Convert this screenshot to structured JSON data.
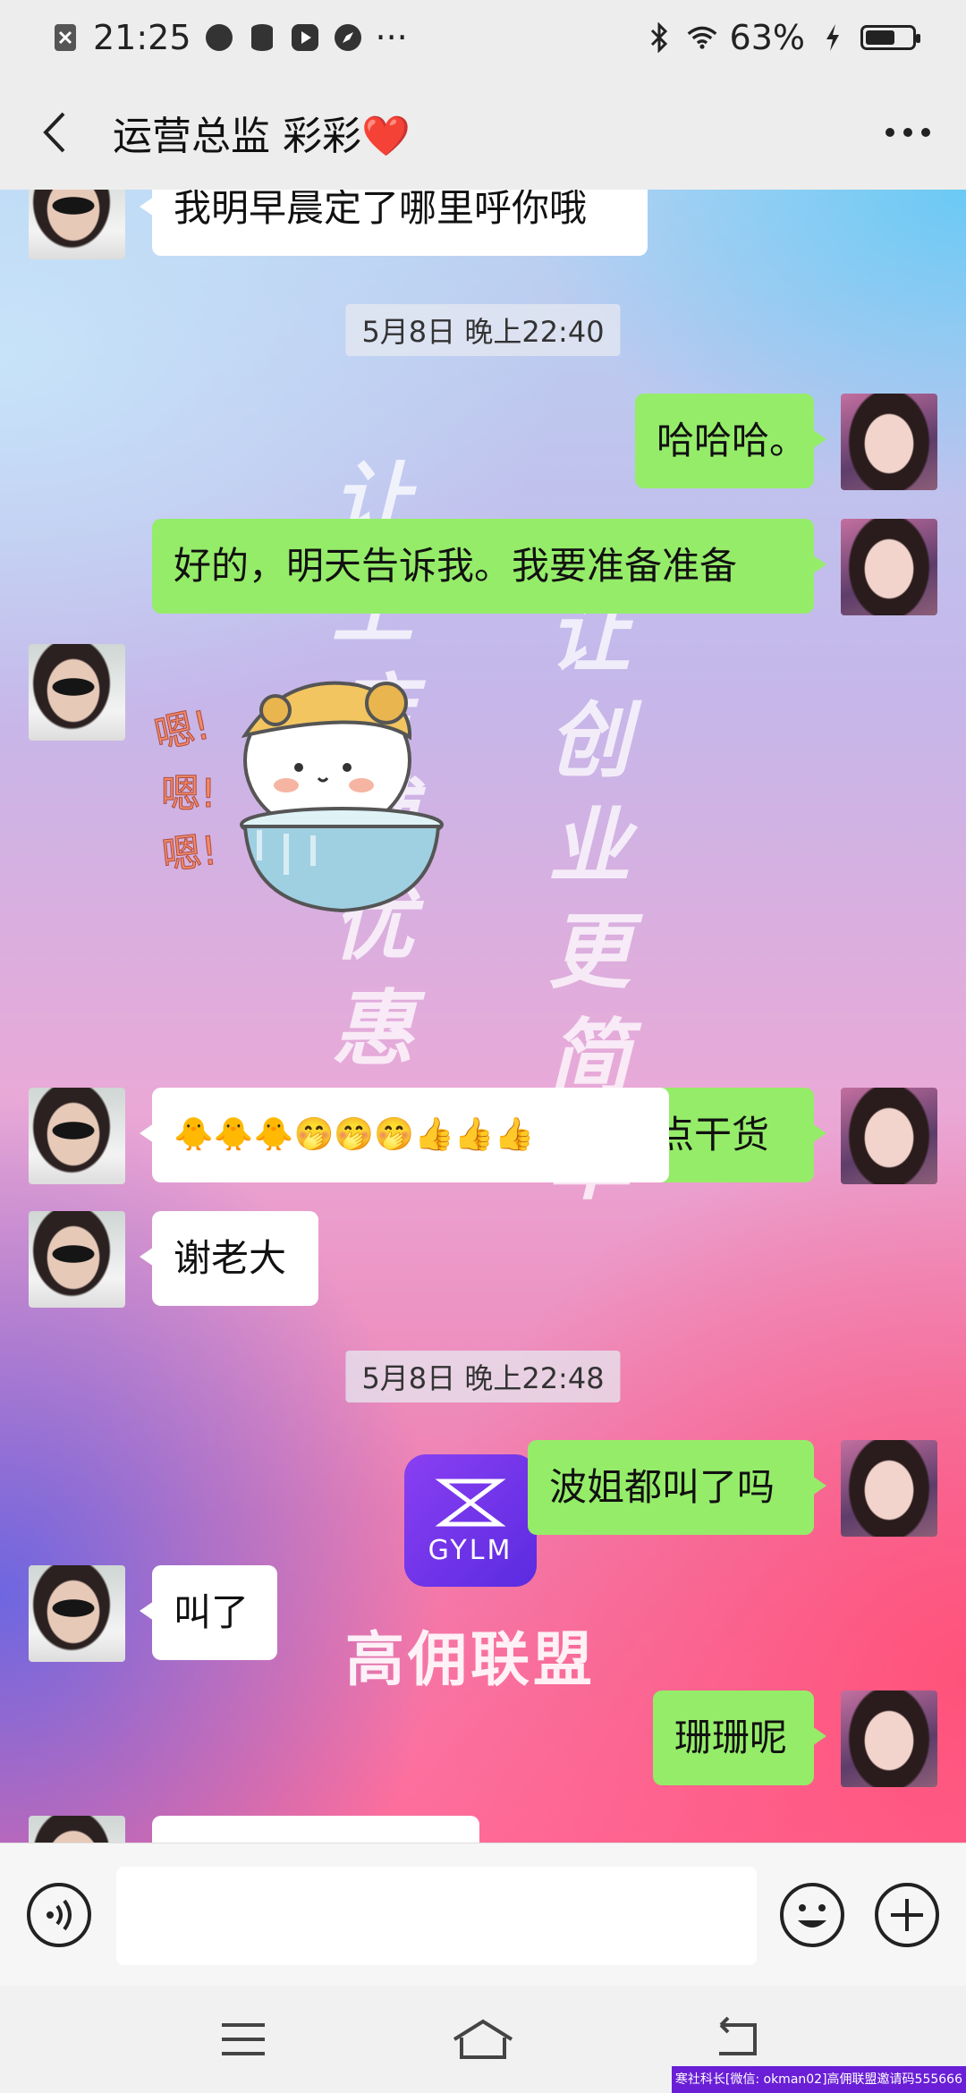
{
  "status_bar": {
    "time": "21:25",
    "more": "···",
    "battery": "63%",
    "battery_level": 0.63
  },
  "header": {
    "back_icon": "chevron-left-icon",
    "title": "运营总监 彩彩❤️",
    "more_icon": "ellipsis-icon"
  },
  "background": {
    "watermark_left": "让上店铺优惠",
    "watermark_right": "让创业更简单",
    "logo_text": "GYLM",
    "brand_name": "高佣联盟"
  },
  "messages": [
    {
      "side": "in",
      "text": "我明早晨定了哪里呼你哦"
    },
    {
      "side": "time",
      "text": "5月8日 晚上22:40"
    },
    {
      "side": "out",
      "text": "哈哈哈。"
    },
    {
      "side": "out",
      "text": "好的，明天告诉我。我要准备准备"
    },
    {
      "side": "in",
      "type": "sticker",
      "sticker_text": [
        "嗯!",
        "嗯!",
        "嗯!"
      ]
    },
    {
      "side": "out",
      "text": "准备分享点干货"
    },
    {
      "side": "in",
      "text": "🐥🐥🐥🤭🤭🤭👍👍👍"
    },
    {
      "side": "in",
      "text": "谢老大"
    },
    {
      "side": "time",
      "text": "5月8日 晚上22:48"
    },
    {
      "side": "out",
      "text": "波姐都叫了吗"
    },
    {
      "side": "in",
      "text": "叫了"
    },
    {
      "side": "out",
      "text": "珊珊呢"
    }
  ],
  "input_bar": {
    "voice_icon": "voice-icon",
    "input_value": "",
    "emoji_icon": "emoji-icon",
    "plus_icon": "plus-icon"
  },
  "nav_bar": {
    "menu_icon": "menu-icon",
    "home_icon": "home-icon",
    "back_icon": "back-icon"
  },
  "footer_note": "寒社科长[微信: okman02]高佣联盟邀请码555666",
  "colors": {
    "bubble_out": "#95ec69",
    "bubble_in": "#ffffff",
    "header_bg": "#ededed"
  }
}
